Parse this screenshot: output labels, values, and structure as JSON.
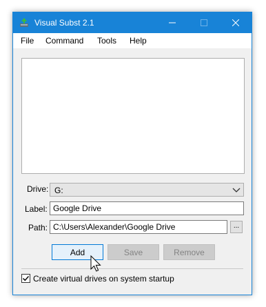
{
  "window": {
    "title": "Visual Subst 2.1"
  },
  "menu": [
    "File",
    "Command",
    "Tools",
    "Help"
  ],
  "drive": {
    "label": "Drive:",
    "value": "G:"
  },
  "label_field": {
    "label": "Label:",
    "value": "Google Drive"
  },
  "path_field": {
    "label": "Path:",
    "value": "C:\\Users\\Alexander\\Google Drive",
    "browse_label": "..."
  },
  "buttons": {
    "add": "Add",
    "save": "Save",
    "remove": "Remove"
  },
  "startup_checkbox": {
    "label": "Create virtual drives on system startup",
    "checked": true
  },
  "colors": {
    "titlebar": "#1883d7",
    "accent": "#0078d7"
  }
}
